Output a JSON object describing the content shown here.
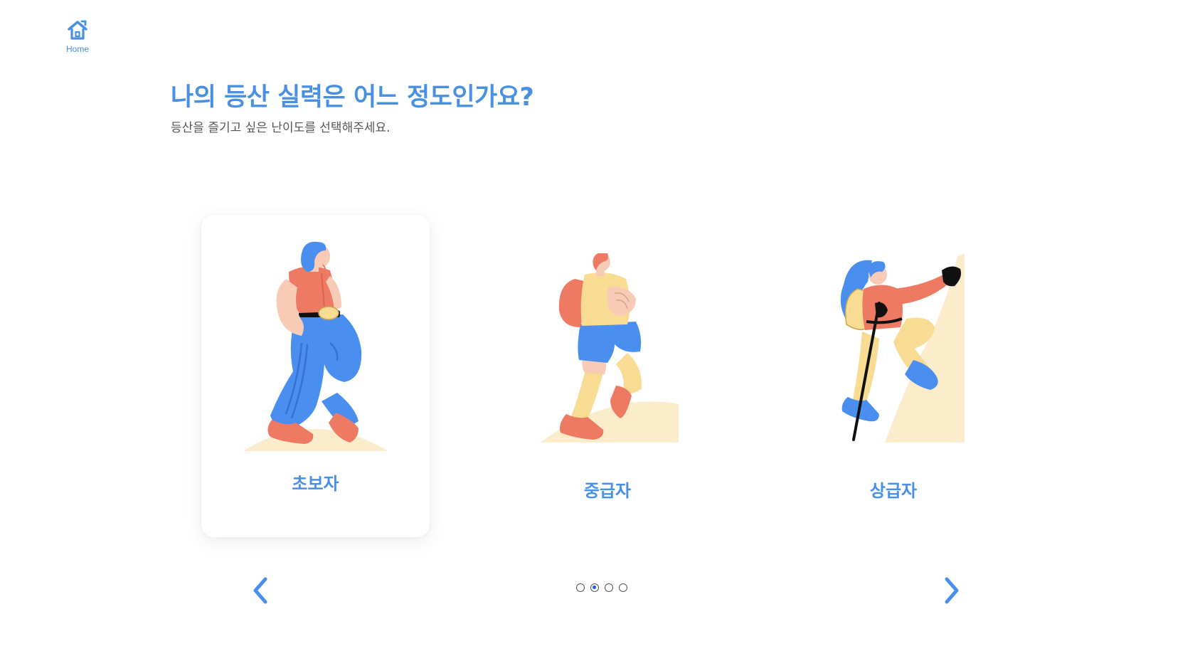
{
  "nav": {
    "home_label": "Home",
    "home_icon": "home-icon"
  },
  "header": {
    "title": "나의 등산 실력은 어느 정도인가요?",
    "subtitle": "등산을 즐기고 싶은 난이도를 선택해주세요."
  },
  "levels": [
    {
      "label": "초보자",
      "illustration": "hiker-walking-illustration",
      "selected": true
    },
    {
      "label": "중급자",
      "illustration": "hiker-backpack-illustration",
      "selected": false
    },
    {
      "label": "상급자",
      "illustration": "climber-rock-wall-illustration",
      "selected": false
    }
  ],
  "pagination": {
    "total": 4,
    "current_page": 2
  },
  "colors": {
    "accent": "#4a90e2",
    "coral": "#ee7a63",
    "blue": "#4a8ff0",
    "cream": "#fbedcc",
    "skin": "#f7cbb5",
    "yellow": "#f8dc93"
  }
}
